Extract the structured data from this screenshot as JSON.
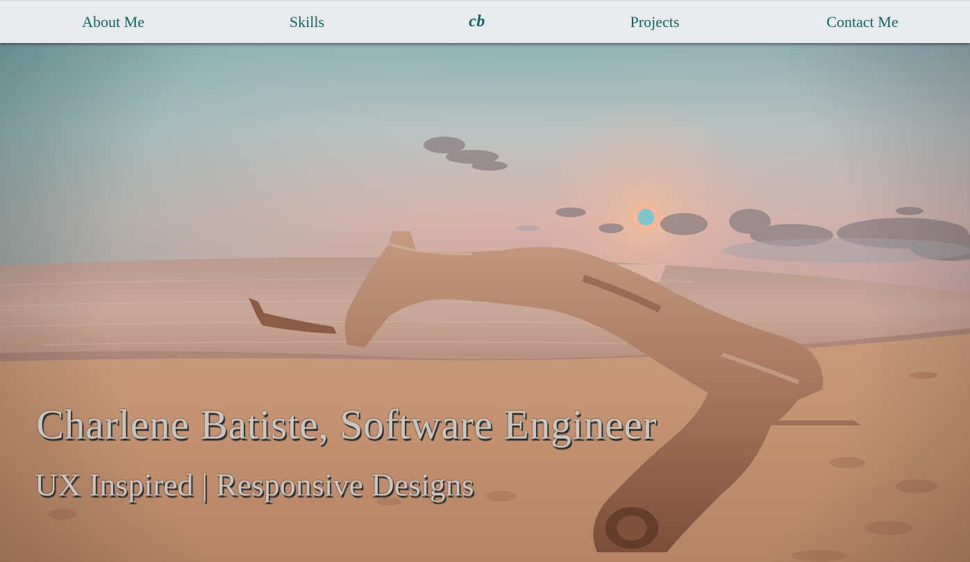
{
  "nav": {
    "about": "About Me",
    "skills": "Skills",
    "logo": "cb",
    "projects": "Projects",
    "contact": "Contact Me"
  },
  "hero": {
    "title": "Charlene Batiste, Software Engineer",
    "subtitle": "UX Inspired | Responsive Designs"
  },
  "colors": {
    "nav_bg": "#e8eaeb",
    "nav_text": "#0f6466",
    "hero_text": "#c9c6c1"
  }
}
